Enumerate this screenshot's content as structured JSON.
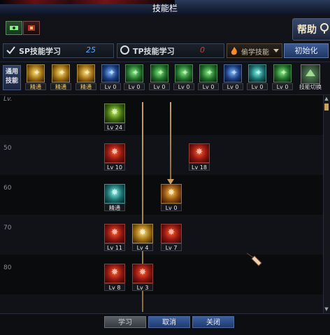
{
  "window": {
    "title": "技能栏"
  },
  "header": {
    "help_label": "帮助",
    "sp": {
      "label": "SP技能学习",
      "value": "25",
      "color": "#5aa8ff"
    },
    "tp": {
      "label": "TP技能学习",
      "value": "0",
      "color": "#e23a2a"
    },
    "learn_select": {
      "value": "偷学技能"
    },
    "reset_label": "初始化",
    "tab_icons": [
      "skill-tab-icon",
      "item-tab-icon"
    ]
  },
  "slot_row": {
    "label": "通用技能",
    "slots": [
      {
        "icon": "warrior-skill-icon",
        "level": "精通",
        "color": "gold"
      },
      {
        "icon": "flame-warrior-icon",
        "level": "精通",
        "color": "gold"
      },
      {
        "icon": "leap-skill-icon",
        "level": "精通",
        "color": "gold"
      },
      {
        "icon": "eagle-skill-icon",
        "level": "Lv 0",
        "color": "blue"
      },
      {
        "icon": "crosshair-skill-icon",
        "level": "Lv 0",
        "color": "greeny"
      },
      {
        "icon": "target-skill-icon",
        "level": "Lv 0",
        "color": "greeny"
      },
      {
        "icon": "kick-skill-icon",
        "level": "Lv 0",
        "color": "greeny"
      },
      {
        "icon": "dash-skill-icon",
        "level": "Lv 0",
        "color": "greeny"
      },
      {
        "icon": "orb-skill-icon",
        "level": "Lv 0",
        "color": "blue"
      },
      {
        "icon": "armor-skill-icon",
        "level": "Lv 0",
        "color": "teal"
      },
      {
        "icon": "sprint-skill-icon",
        "level": "Lv 0",
        "color": "greeny"
      }
    ],
    "swap_label": "技能切换"
  },
  "tree": {
    "level_header": "Lv.",
    "bands": [
      "50",
      "60",
      "70",
      "80"
    ],
    "skills": [
      {
        "icon": "awakening-skill-icon",
        "level": "Lv 24",
        "color": "green"
      },
      {
        "icon": "blood-strike-icon",
        "level": "Lv 10",
        "color": "red"
      },
      {
        "icon": "rage-skill-icon",
        "level": "Lv 18",
        "color": "red"
      },
      {
        "icon": "claw-skill-icon",
        "level": "精通",
        "color": "teal"
      },
      {
        "icon": "burst-skill-icon",
        "level": "Lv 0",
        "color": "amber"
      },
      {
        "icon": "fire-fist-icon",
        "level": "Lv 11",
        "color": "red"
      },
      {
        "icon": "golden-blast-icon",
        "level": "Lv 4",
        "color": "gold"
      },
      {
        "icon": "crimson-slash-icon",
        "level": "Lv 7",
        "color": "red"
      },
      {
        "icon": "demon-skill-icon",
        "level": "Lv 8",
        "color": "red"
      },
      {
        "icon": "inferno-skill-icon",
        "level": "Lv 3",
        "color": "red"
      }
    ]
  },
  "buttons": {
    "learn": "学习",
    "cancel": "取消",
    "close": "关闭"
  }
}
